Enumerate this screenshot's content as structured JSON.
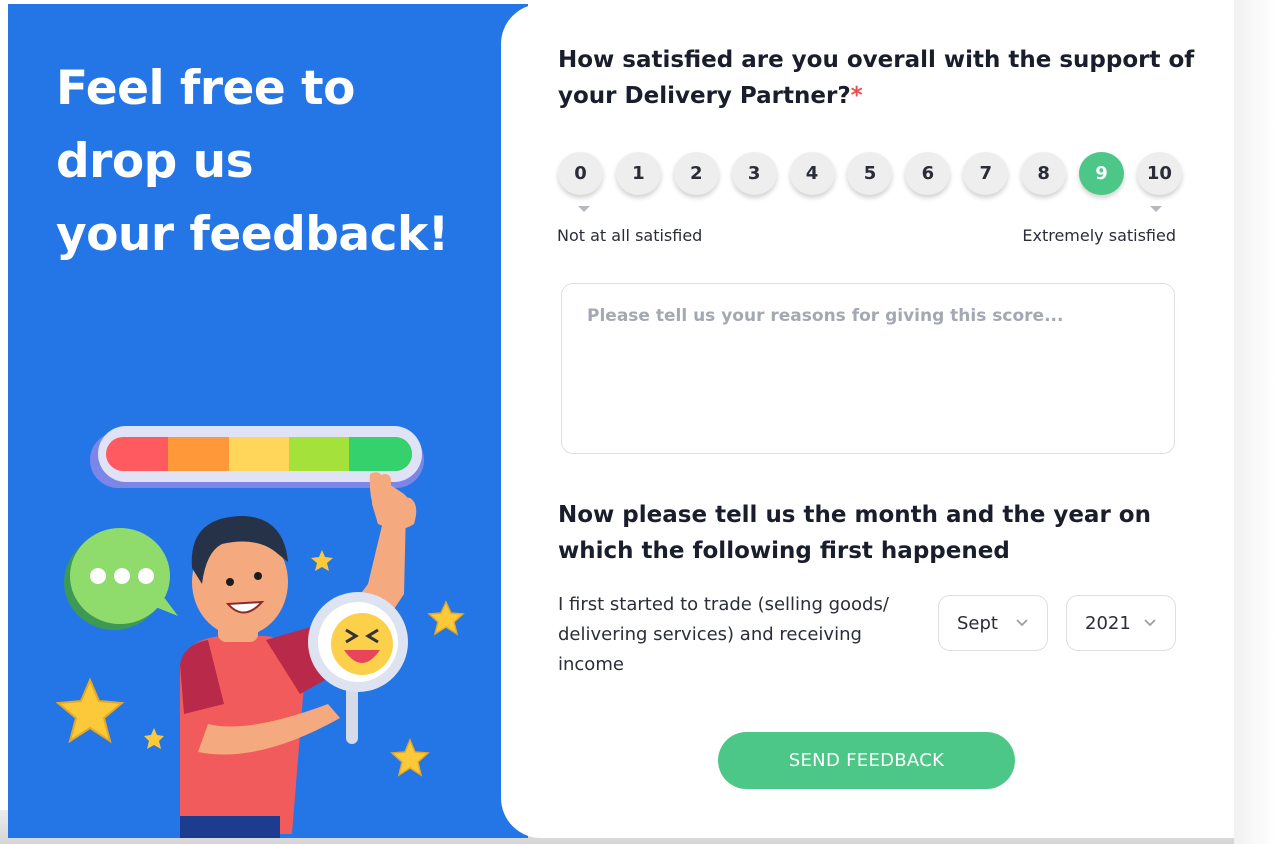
{
  "hero": {
    "lines": [
      "Feel free to",
      "drop us",
      "your feedback!"
    ]
  },
  "question1": {
    "text": "How satisfied are you overall with the support of your Delivery Partner?",
    "required_mark": "*"
  },
  "scale": {
    "options": [
      "0",
      "1",
      "2",
      "3",
      "4",
      "5",
      "6",
      "7",
      "8",
      "9",
      "10"
    ],
    "selected": "9",
    "low_label": "Not at all satisfied",
    "high_label": "Extremely satisfied"
  },
  "reasons": {
    "value": "",
    "placeholder": "Please tell us your reasons for giving this score..."
  },
  "question2": {
    "text": "Now please tell us the month and the year on which the following first happened"
  },
  "trade": {
    "description": "I first started to trade (selling goods/ delivering services) and receiving income",
    "month": "Sept",
    "year": "2021"
  },
  "submit_label": "SEND FEEDBACK",
  "colors": {
    "panel_blue": "#2476e6",
    "accent_green": "#4cc788",
    "required_red": "#ee4d4d"
  },
  "icons": [
    "chevron-down-icon",
    "speech-bubble-icon",
    "star-icon",
    "smiley-icon"
  ]
}
